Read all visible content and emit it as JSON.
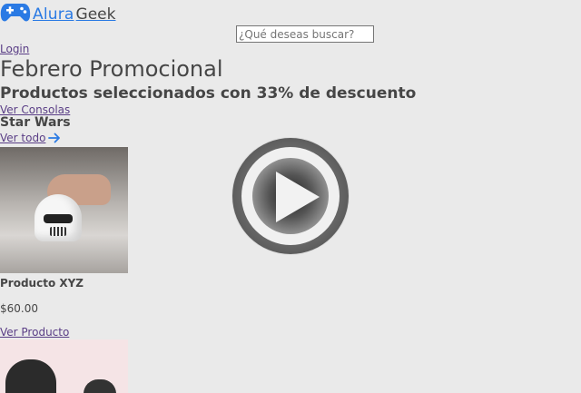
{
  "header": {
    "logo_alura": "Alura",
    "logo_geek": "Geek",
    "search_placeholder": "¿Qué deseas buscar?",
    "login_label": "Login",
    "logo_icon": "gamepad-icon"
  },
  "hero": {
    "title": "Febrero Promocional",
    "subtitle": "Productos seleccionados con 33% de descuento",
    "cta_label": "Ver Consolas"
  },
  "category": {
    "title": "Star Wars",
    "see_all_label": "Ver todo",
    "see_all_icon": "arrow-right-icon"
  },
  "products": [
    {
      "name": "Producto XYZ",
      "price": "$60.00",
      "link_label": "Ver Producto"
    }
  ],
  "overlay": {
    "icon": "play-icon"
  },
  "colors": {
    "accent": "#2a7ae4",
    "text": "#464646",
    "background": "#eaeaea",
    "link_visited": "#5a3e86"
  }
}
